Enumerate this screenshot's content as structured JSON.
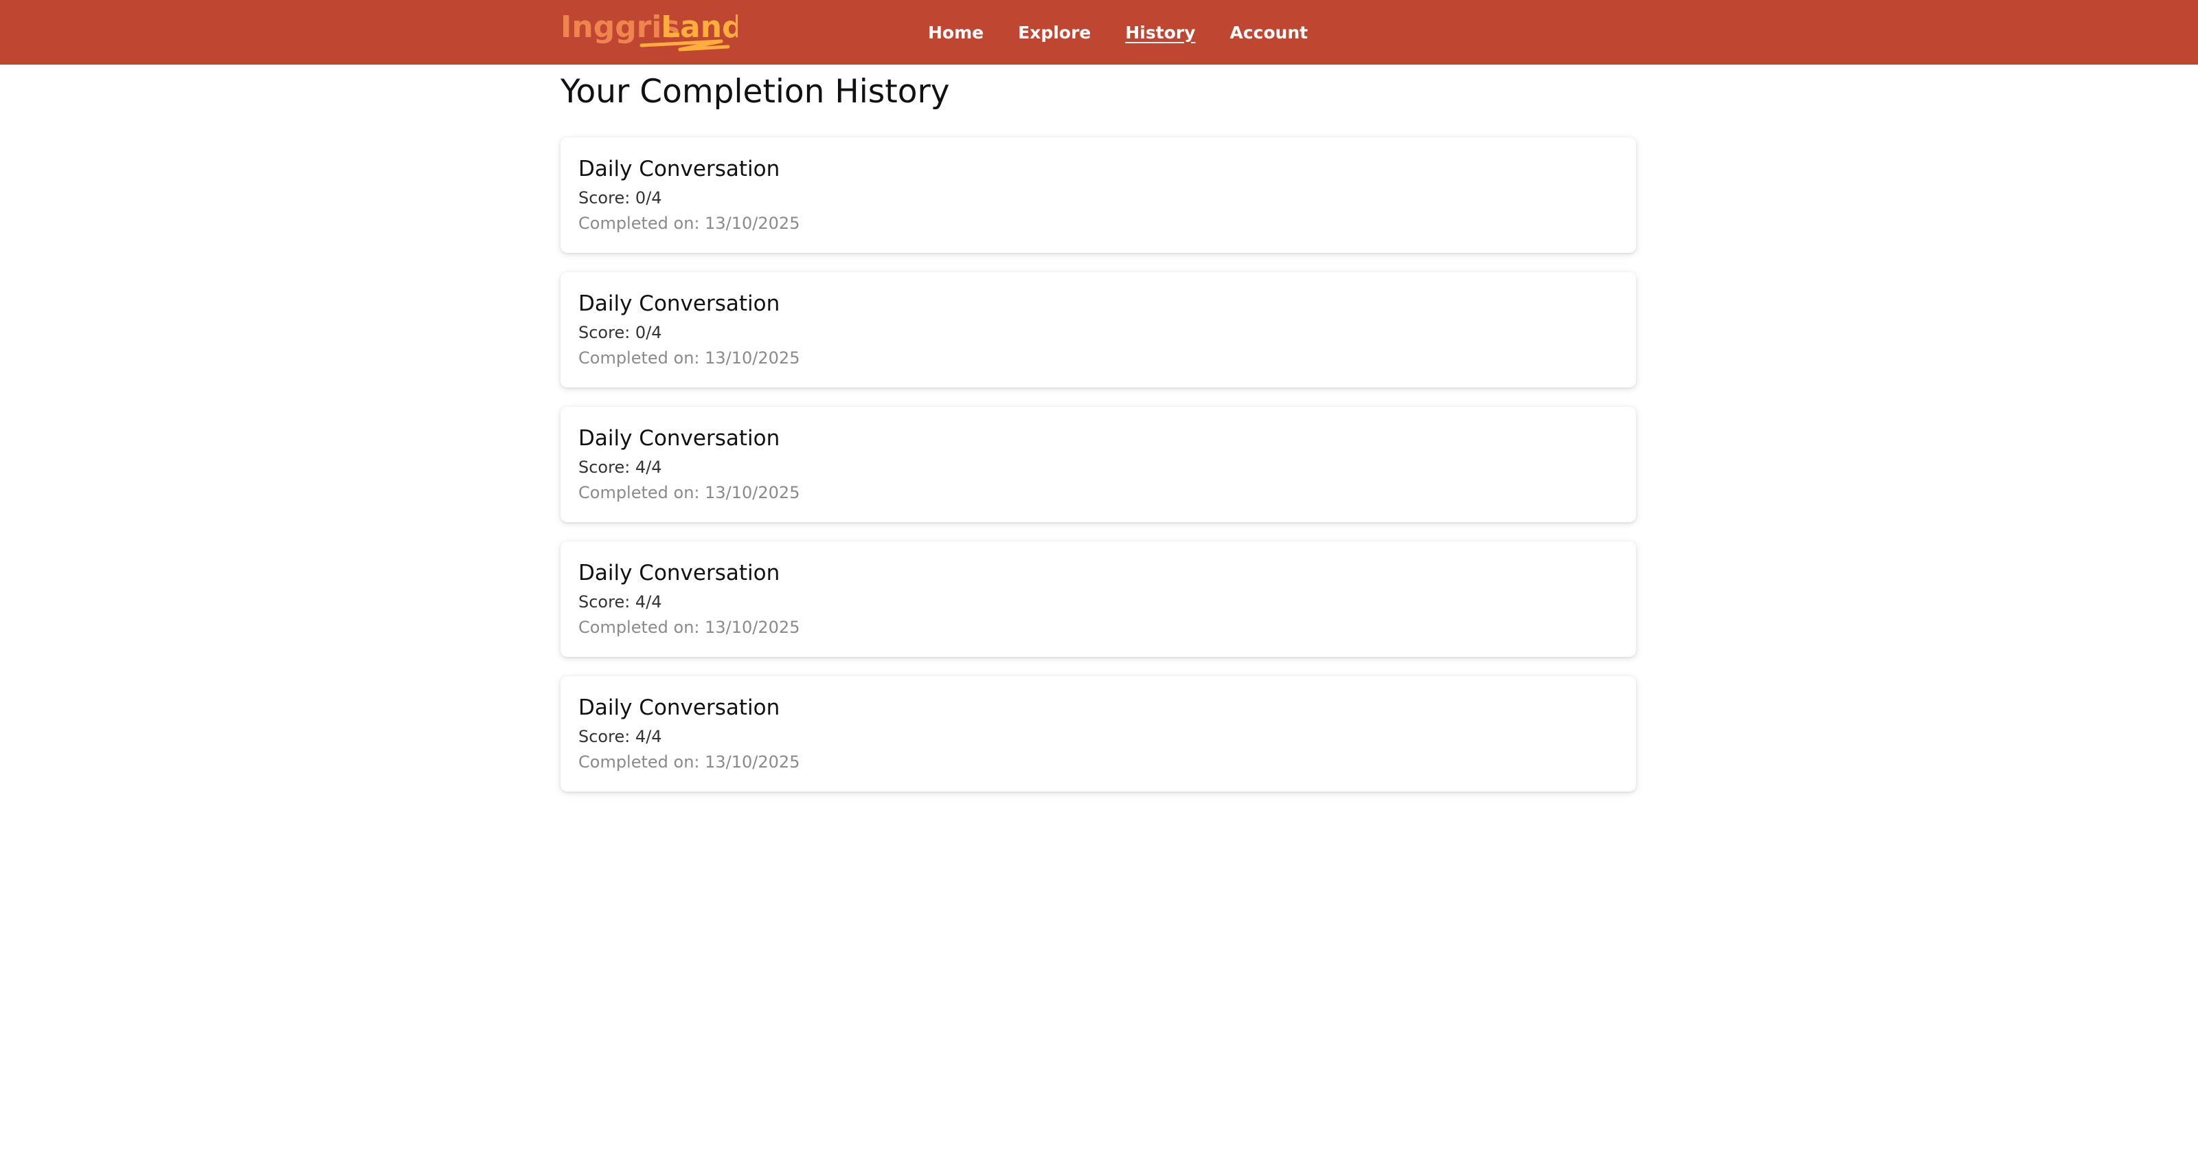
{
  "header": {
    "logo_text": "InggrisLand",
    "logo_colors": {
      "primary": "#f0844f",
      "accent": "#ffae3d"
    },
    "background": "#bf4731",
    "nav": [
      {
        "label": "Home",
        "active": false
      },
      {
        "label": "Explore",
        "active": false
      },
      {
        "label": "History",
        "active": true
      },
      {
        "label": "Account",
        "active": false
      }
    ]
  },
  "main": {
    "title": "Your Completion History",
    "history": [
      {
        "title": "Daily Conversation",
        "score": "Score: 0/4",
        "completed": "Completed on: 13/10/2025"
      },
      {
        "title": "Daily Conversation",
        "score": "Score: 0/4",
        "completed": "Completed on: 13/10/2025"
      },
      {
        "title": "Daily Conversation",
        "score": "Score: 4/4",
        "completed": "Completed on: 13/10/2025"
      },
      {
        "title": "Daily Conversation",
        "score": "Score: 4/4",
        "completed": "Completed on: 13/10/2025"
      },
      {
        "title": "Daily Conversation",
        "score": "Score: 4/4",
        "completed": "Completed on: 13/10/2025"
      }
    ]
  }
}
